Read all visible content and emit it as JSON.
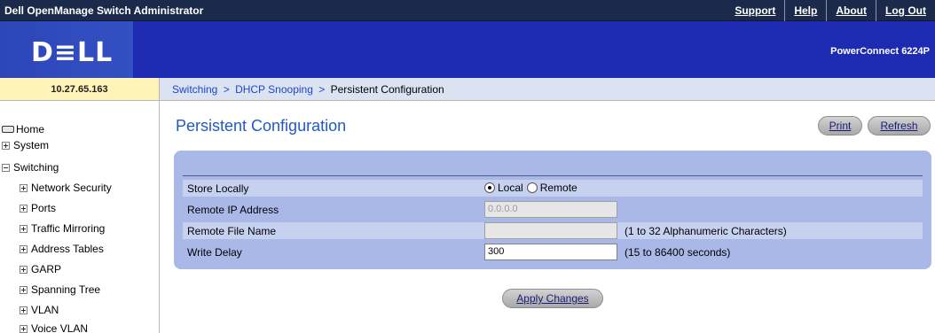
{
  "app": {
    "title": "Dell OpenManage Switch Administrator",
    "top_links": [
      "Support",
      "Help",
      "About",
      "Log Out"
    ],
    "logo_text": "D≡LL",
    "product": "PowerConnect 6224P"
  },
  "ip_address": "10.27.65.163",
  "breadcrumb": {
    "items": [
      "Switching",
      "DHCP Snooping"
    ],
    "separator": ">",
    "current": "Persistent Configuration"
  },
  "sidebar": {
    "items": [
      {
        "label": "Home",
        "icon": "home-icon"
      },
      {
        "label": "System",
        "state": "collapsed"
      },
      {
        "label": "Switching",
        "state": "expanded"
      },
      {
        "label": "Network Security",
        "state": "collapsed"
      },
      {
        "label": "Ports",
        "state": "collapsed"
      },
      {
        "label": "Traffic Mirroring",
        "state": "collapsed"
      },
      {
        "label": "Address Tables",
        "state": "collapsed"
      },
      {
        "label": "GARP",
        "state": "collapsed"
      },
      {
        "label": "Spanning Tree",
        "state": "collapsed"
      },
      {
        "label": "VLAN",
        "state": "collapsed"
      },
      {
        "label": "Voice VLAN",
        "state": "collapsed"
      }
    ]
  },
  "page": {
    "title": "Persistent Configuration",
    "print_label": "Print",
    "refresh_label": "Refresh",
    "apply_label": "Apply Changes"
  },
  "form": {
    "store_locally": {
      "label": "Store Locally",
      "options": [
        "Local",
        "Remote"
      ],
      "selected": "Local"
    },
    "remote_ip": {
      "label": "Remote IP Address",
      "value": "0.0.0.0"
    },
    "remote_file": {
      "label": "Remote File Name",
      "value": "",
      "hint": "(1 to 32 Alphanumeric Characters)"
    },
    "write_delay": {
      "label": "Write Delay",
      "value": "300",
      "hint": "(15 to 86400 seconds)"
    }
  },
  "colors": {
    "top_bar": "#1b2a4a",
    "banner": "#1d2bb2",
    "ip_bar": "#fff3b8",
    "breadcrumb_bar": "#dbe3f3",
    "form_panel": "#a9b8e6",
    "title": "#2259c4"
  }
}
